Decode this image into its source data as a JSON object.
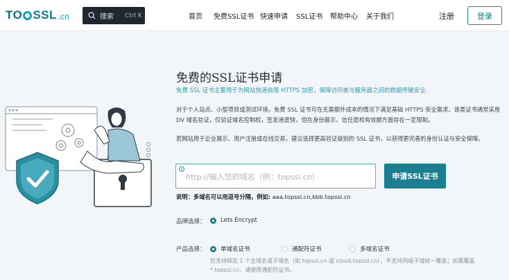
{
  "header": {
    "logo_to": "TO",
    "logo_rest": "SSL",
    "logo_cn": ".cn",
    "search_label": "搜索",
    "search_shortcut": "Ctrl K",
    "nav": [
      "首页",
      "免费SSL证书",
      "快速申请",
      "SSL证书",
      "帮助中心",
      "关于我们"
    ],
    "register": "注册",
    "login": "登录"
  },
  "main": {
    "title": "免费的SSL证书申请",
    "subtitle": "免费 SSL 证书主要用于为网站快速启用 HTTPS 加密，保障访问者与服务器之间的数据传输安全.",
    "para1": "对于个人站点、小型项目或测试环境，免费 SSL 证书可在无需额外成本的情况下满足基础 HTTPS 安全需求。该类证书通常采用 DV 域名验证，仅验证域名控制权，签发速度快，但在身份展示、信任度和有效期方面存在一定限制。",
    "para2": "若网站用于企业展示、用户注册或在线交易，建议选择更高验证级别的 SSL 证书，以获得更完善的身份认证与安全保障。",
    "domain_input": {
      "placeholder": "http://输入您的域名（例：topssl.cn）",
      "value": ""
    },
    "apply_button": "申请SSL证书",
    "note_label": "说明：多域名可以用逗号分隔，例如:",
    "note_example": "aaa.topssl.cn,bbb.topssl.cn",
    "brand": {
      "label": "品牌选择：",
      "option": "Lets Encrypt"
    },
    "product": {
      "label": "产品选择：",
      "options": [
        "单域名证书",
        "通配符证书",
        "多域名证书"
      ],
      "selected": "单域名证书"
    },
    "hint": "仅支持绑定 1 个主域名或子域名（如 topssl.cn 或 cloud.topssl.cn），不支持同级子域统一覆盖；如需覆盖 *.topssl.cn，请使用通配符证书。"
  },
  "colors": {
    "accent": "#1a7f91",
    "subtitle": "#2b9bb0",
    "search_bg": "#1f2730",
    "page_bg": "#f3f6f9"
  },
  "icons": [
    "search-icon",
    "shield-check-icon",
    "lock-icon",
    "gear-icon"
  ]
}
